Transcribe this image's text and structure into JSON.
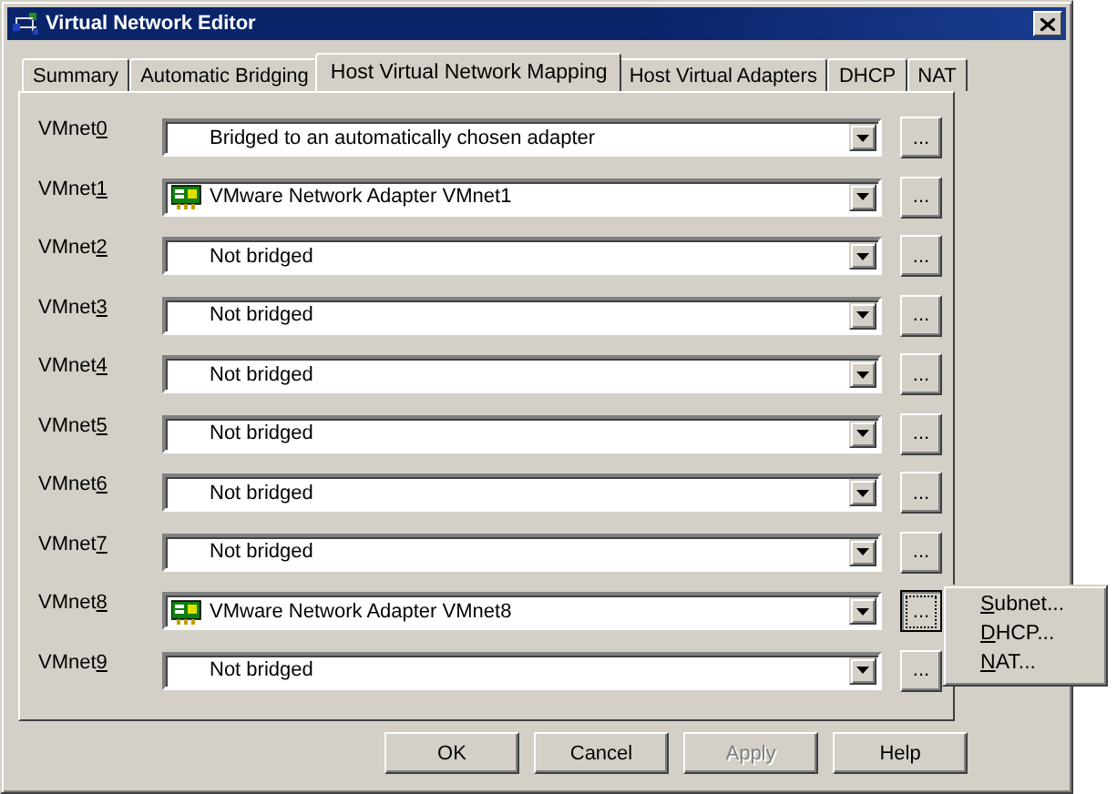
{
  "window": {
    "title": "Virtual Network Editor"
  },
  "tabs": [
    {
      "label": "Summary",
      "selected": false
    },
    {
      "label": "Automatic Bridging",
      "selected": false
    },
    {
      "label": "Host Virtual Network Mapping",
      "selected": true
    },
    {
      "label": "Host Virtual Adapters",
      "selected": false
    },
    {
      "label": "DHCP",
      "selected": false
    },
    {
      "label": "NAT",
      "selected": false
    }
  ],
  "rows": [
    {
      "label": "VMnet0",
      "kind": "plain",
      "value": "Bridged to an automatically chosen adapter",
      "button": "...",
      "pressed": false
    },
    {
      "label": "VMnet1",
      "kind": "adapter",
      "value": "VMware Network Adapter VMnet1",
      "button": "...",
      "pressed": false
    },
    {
      "label": "VMnet2",
      "kind": "plain",
      "value": "Not bridged",
      "button": "...",
      "pressed": false
    },
    {
      "label": "VMnet3",
      "kind": "plain",
      "value": "Not bridged",
      "button": "...",
      "pressed": false
    },
    {
      "label": "VMnet4",
      "kind": "plain",
      "value": "Not bridged",
      "button": "...",
      "pressed": false
    },
    {
      "label": "VMnet5",
      "kind": "plain",
      "value": "Not bridged",
      "button": "...",
      "pressed": false
    },
    {
      "label": "VMnet6",
      "kind": "plain",
      "value": "Not bridged",
      "button": "...",
      "pressed": false
    },
    {
      "label": "VMnet7",
      "kind": "plain",
      "value": "Not bridged",
      "button": "...",
      "pressed": false
    },
    {
      "label": "VMnet8",
      "kind": "adapter",
      "value": "VMware Network Adapter VMnet8",
      "button": "...",
      "pressed": true
    },
    {
      "label": "VMnet9",
      "kind": "plain",
      "value": "Not bridged",
      "button": "...",
      "pressed": false
    }
  ],
  "menu": {
    "items": [
      "Subnet...",
      "DHCP...",
      "NAT..."
    ]
  },
  "buttons": [
    {
      "label": "OK",
      "disabled": false
    },
    {
      "label": "Cancel",
      "disabled": false
    },
    {
      "label": "Apply",
      "disabled": true
    },
    {
      "label": "Help",
      "disabled": false
    }
  ]
}
